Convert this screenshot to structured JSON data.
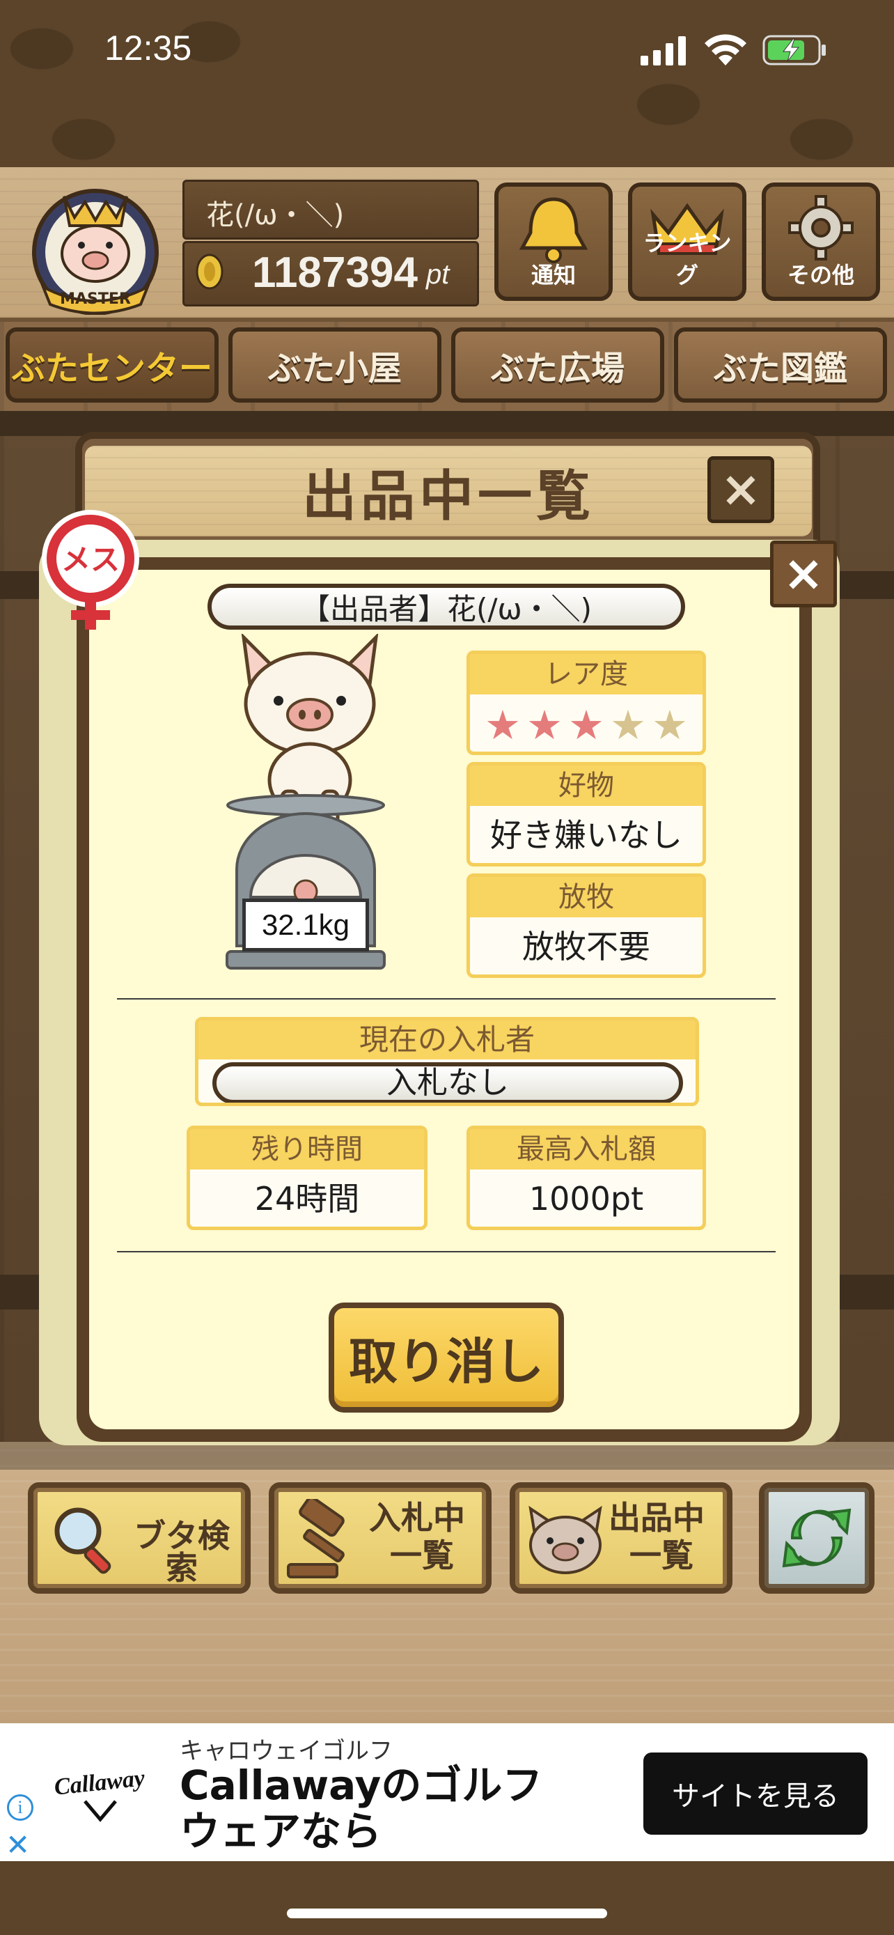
{
  "status_bar": {
    "time": "12:35"
  },
  "header": {
    "badge_text": "MASTER",
    "user_name": "花(/ω・＼)",
    "points": "1187394",
    "points_unit": "pt",
    "buttons": [
      {
        "label": "通知",
        "icon": "bell-icon"
      },
      {
        "label": "ランキング",
        "icon": "crown-icon"
      },
      {
        "label": "その他",
        "icon": "gear-icon"
      }
    ]
  },
  "nav_tabs": [
    {
      "label": "ぶたセンター",
      "active": true
    },
    {
      "label": "ぶた小屋",
      "active": false
    },
    {
      "label": "ぶた広場",
      "active": false
    },
    {
      "label": "ぶた図鑑",
      "active": false
    }
  ],
  "back_panel": {
    "title": "出品中一覧",
    "close": "×"
  },
  "modal": {
    "close": "×",
    "gender_label": "メス",
    "seller": "【出品者】花(/ω・＼)",
    "weight": "32.1kg",
    "rarity": {
      "label": "レア度",
      "stars_filled": 3,
      "stars_total": 5
    },
    "likes": {
      "label": "好物",
      "value": "好き嫌いなし"
    },
    "grazing": {
      "label": "放牧",
      "value": "放牧不要"
    },
    "current_bidder": {
      "label": "現在の入札者",
      "value": "入札なし"
    },
    "time_left": {
      "label": "残り時間",
      "value": "24時間"
    },
    "highest_bid": {
      "label": "最高入札額",
      "value": "1000pt"
    },
    "cancel_label": "取り消し"
  },
  "bottom_buttons": {
    "search": "ブタ検索",
    "bidding_line1": "入札中",
    "bidding_line2": "一覧",
    "listing_line1": "出品中",
    "listing_line2": "一覧",
    "refresh_icon": "refresh-icon"
  },
  "ad": {
    "logo_text": "Callaway",
    "advertiser": "キャロウェイゴルフ",
    "headline": "Callawayのゴルフウェアなら",
    "cta": "サイトを見る"
  },
  "colors": {
    "accent_yellow": "#f8d460",
    "wood_dark": "#5a4026",
    "star_on": "#e57c7c",
    "star_off": "#d6c38f"
  }
}
